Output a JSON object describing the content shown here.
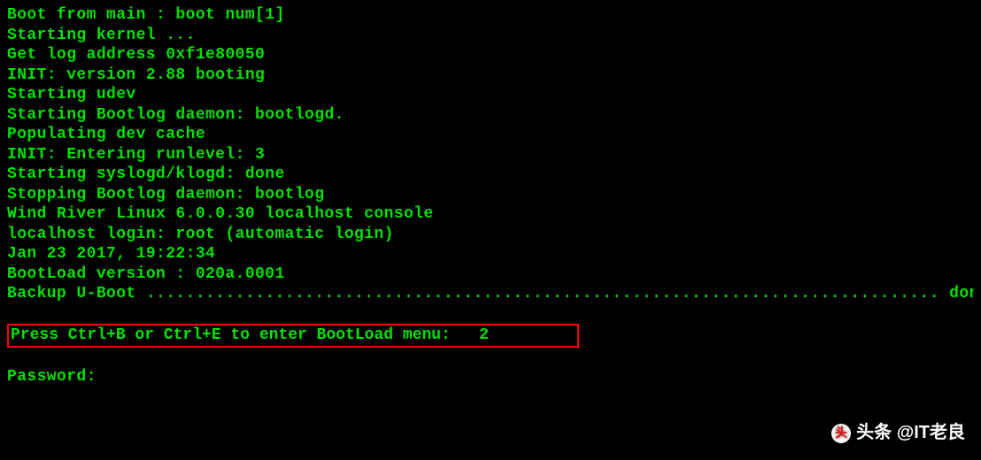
{
  "terminal": {
    "lines": [
      "Boot from main : boot num[1]",
      "",
      "Starting kernel ...",
      "",
      "Get log address 0xf1e80050",
      "INIT: version 2.88 booting",
      "Starting udev",
      "Starting Bootlog daemon: bootlogd.",
      "Populating dev cache",
      "INIT: Entering runlevel: 3",
      "Starting syslogd/klogd: done",
      "Stopping Bootlog daemon: bootlog",
      "Wind River Linux 6.0.0.30 localhost console",
      "",
      "localhost login: root (automatic login)",
      "",
      "Jan 23 2017, 19:22:34",
      "BootLoad version : 020a.0001"
    ],
    "backup_line": "Backup U-Boot ................................................................................ done",
    "highlighted": "Press Ctrl+B or Ctrl+E to enter BootLoad menu:   2",
    "password_prompt": "Password:"
  },
  "watermark": {
    "icon_text": "头",
    "text": "头条 @IT老良"
  }
}
